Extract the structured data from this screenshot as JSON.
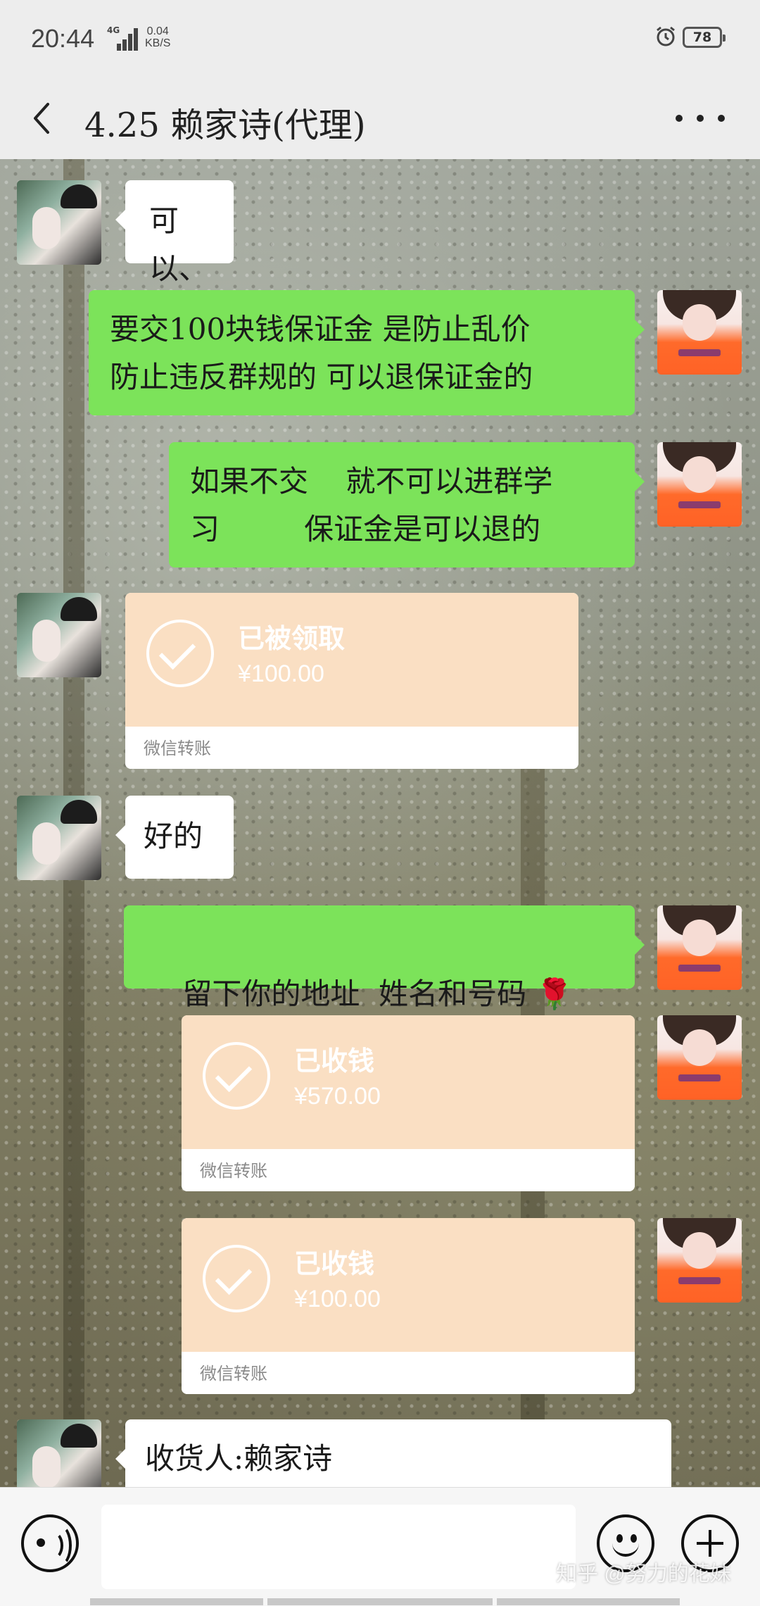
{
  "status_bar": {
    "time": "20:44",
    "network_type": "4G",
    "net_speed_value": "0.04",
    "net_speed_unit": "KB/S",
    "battery_level": "78"
  },
  "header": {
    "title": "4.25   赖家诗(代理)"
  },
  "messages": [
    {
      "side": "left",
      "type": "text",
      "text": "可以、"
    },
    {
      "side": "right",
      "type": "text",
      "lines": [
        "要交100块钱保证金  是防止乱价",
        "防止违反群规的  可以退保证金的"
      ]
    },
    {
      "side": "right",
      "type": "text",
      "lines": [
        "如果不交    就不可以进群学",
        "习         保证金是可以退的"
      ]
    },
    {
      "side": "left",
      "type": "transfer",
      "status": "已被领取",
      "amount": "¥100.00",
      "source": "微信转账"
    },
    {
      "side": "left",
      "type": "text",
      "text": "好的"
    },
    {
      "side": "right",
      "type": "text",
      "text": "留下你的地址  姓名和号码 🌹"
    },
    {
      "side": "right",
      "type": "transfer",
      "status": "已收钱",
      "amount": "¥570.00",
      "source": "微信转账"
    },
    {
      "side": "right",
      "type": "transfer",
      "status": "已收钱",
      "amount": "¥100.00",
      "source": "微信转账"
    },
    {
      "side": "left",
      "type": "text",
      "text": "收货人:赖家诗"
    }
  ],
  "input_bar": {
    "placeholder": ""
  },
  "icons": {
    "back": "chevron-left-icon",
    "more": "more-dots-icon",
    "voice": "voice-icon",
    "emoji": "emoji-icon",
    "plus": "plus-icon",
    "alarm": "alarm-icon"
  },
  "watermark": "知乎 @努力的花妹",
  "colors": {
    "green_bubble": "#7ce35a",
    "white_bubble": "#ffffff",
    "transfer_card": "#fadfc3",
    "bar_background": "#ededed"
  }
}
